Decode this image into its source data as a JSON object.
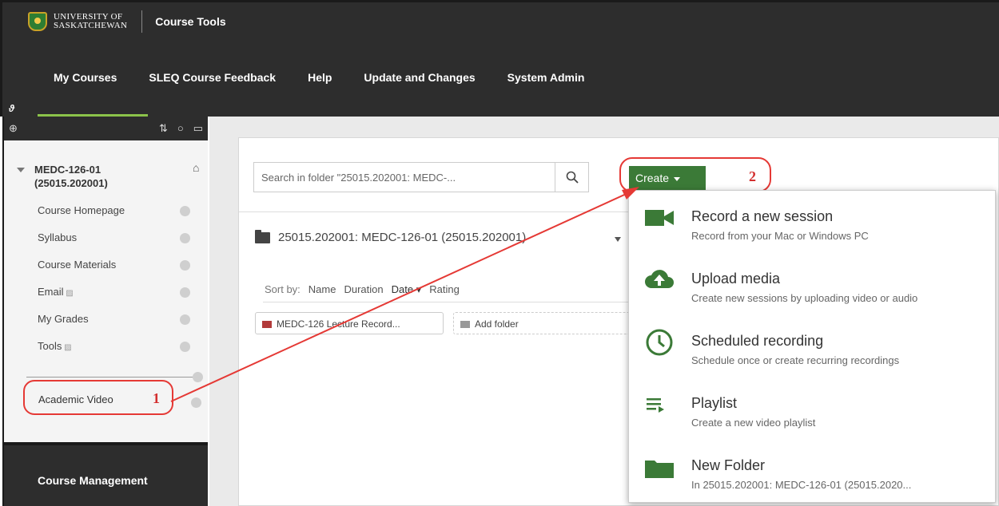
{
  "header": {
    "university_line1": "UNIVERSITY OF",
    "university_line2": "SASKATCHEWAN",
    "product": "Course Tools",
    "nav": [
      "My Courses",
      "SLEQ Course Feedback",
      "Help",
      "Update and Changes",
      "System Admin"
    ]
  },
  "sidebar": {
    "course_name": "MEDC-126-01",
    "course_code": "(25015.202001)",
    "items": [
      "Course Homepage",
      "Syllabus",
      "Course Materials",
      "Email",
      "My Grades",
      "Tools"
    ],
    "highlight_item": "Academic Video",
    "annotation_1": "1",
    "footer": "Course Management"
  },
  "main": {
    "search_placeholder": "Search in folder \"25015.202001: MEDC-...",
    "create_label": "Create",
    "annotation_2": "2",
    "folder_title": "25015.202001: MEDC-126-01 (25015.202001)",
    "sort_label": "Sort by:",
    "sort_options": [
      "Name",
      "Duration",
      "Date",
      "Rating"
    ],
    "folder_chip": "MEDC-126 Lecture Record...",
    "add_folder": "Add folder"
  },
  "dropdown": {
    "items": [
      {
        "title": "Record a new session",
        "subtitle": "Record from your Mac or Windows PC",
        "icon": "video-camera-icon"
      },
      {
        "title": "Upload media",
        "subtitle": "Create new sessions by uploading video or audio",
        "icon": "cloud-upload-icon"
      },
      {
        "title": "Scheduled recording",
        "subtitle": "Schedule once or create recurring recordings",
        "icon": "clock-icon"
      },
      {
        "title": "Playlist",
        "subtitle": "Create a new video playlist",
        "icon": "playlist-icon"
      },
      {
        "title": "New Folder",
        "subtitle": "In 25015.202001: MEDC-126-01 (25015.2020...",
        "icon": "folder-icon"
      }
    ]
  },
  "colors": {
    "accent": "#3b7a37",
    "annotation": "#e53935",
    "nav_underline": "#8bc34a",
    "dark_bg": "#2d2d2d"
  }
}
